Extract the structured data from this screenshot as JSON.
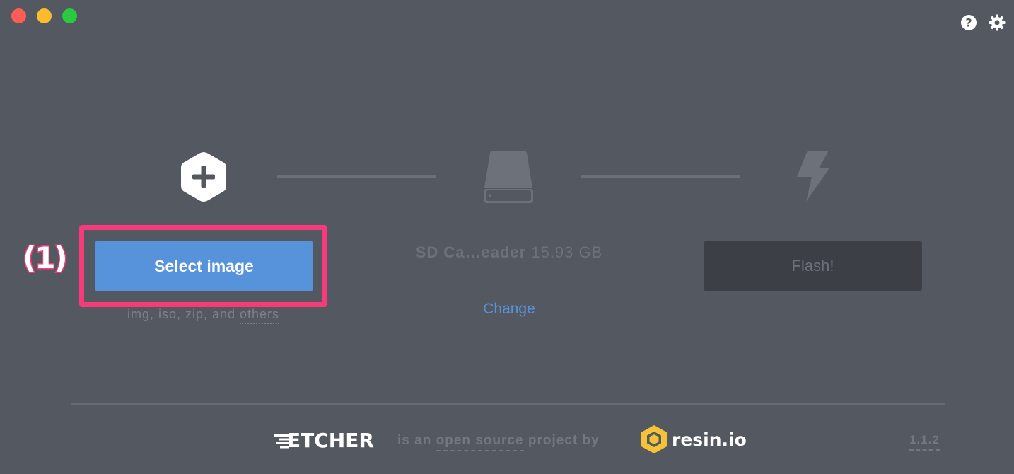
{
  "window": {
    "controls": [
      "close",
      "minimize",
      "maximize"
    ]
  },
  "header": {
    "icons": [
      "help-icon",
      "settings-icon"
    ]
  },
  "steps": {
    "image": {
      "icon": "plus-hexagon-icon",
      "button_label": "Select image",
      "formats_prefix": "img, iso, zip, and ",
      "formats_link": "others"
    },
    "drive": {
      "icon": "drive-icon",
      "name": "SD Ca…eader",
      "size": "15.93 GB",
      "change_label": "Change"
    },
    "flash": {
      "icon": "lightning-icon",
      "button_label": "Flash!"
    }
  },
  "annotation": {
    "label": "(1)",
    "color": "#f73a79"
  },
  "footer": {
    "etcher_logo": "ETCHER",
    "text_prefix": "is an ",
    "text_link": "open source",
    "text_suffix": " project by",
    "resin_logo": "resin.io",
    "version": "1.1.2"
  },
  "colors": {
    "background": "#545860",
    "accent": "#5793db",
    "disabled_button": "#3c3f45"
  }
}
